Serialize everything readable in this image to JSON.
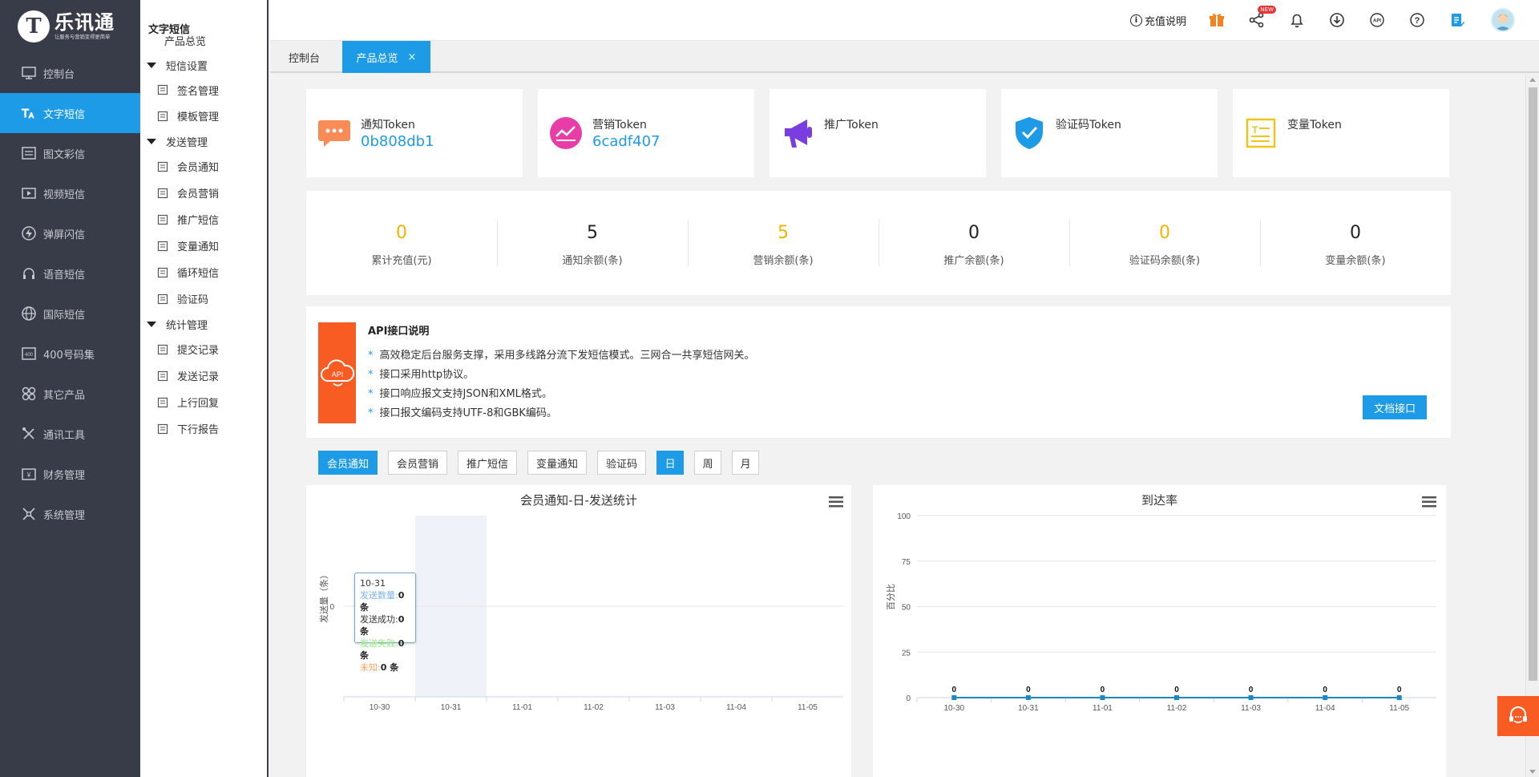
{
  "brand": {
    "title": "乐讯通",
    "subtitle": "让服务与营销变得更简单",
    "mark": "T"
  },
  "sidebar": {
    "items": [
      {
        "label": "控制台",
        "icon": "monitor-icon"
      },
      {
        "label": "文字短信",
        "icon": "text-icon",
        "active": true
      },
      {
        "label": "图文彩信",
        "icon": "image-icon"
      },
      {
        "label": "视频短信",
        "icon": "video-icon"
      },
      {
        "label": "弹屏闪信",
        "icon": "flash-icon"
      },
      {
        "label": "语音短信",
        "icon": "headset-icon"
      },
      {
        "label": "国际短信",
        "icon": "globe-icon"
      },
      {
        "label": "400号码集",
        "icon": "400-icon"
      },
      {
        "label": "其它产品",
        "icon": "grid-icon"
      },
      {
        "label": "通讯工具",
        "icon": "tools-icon"
      },
      {
        "label": "财务管理",
        "icon": "wallet-icon"
      },
      {
        "label": "系统管理",
        "icon": "settings-icon"
      }
    ]
  },
  "submenu": {
    "title": "文字短信",
    "overview": "产品总览",
    "groups": [
      {
        "label": "短信设置",
        "items": [
          "签名管理",
          "模板管理"
        ]
      },
      {
        "label": "发送管理",
        "items": [
          "会员通知",
          "会员营销",
          "推广短信",
          "变量通知",
          "循环短信",
          "验证码"
        ]
      },
      {
        "label": "统计管理",
        "items": [
          "提交记录",
          "发送记录",
          "上行回复",
          "下行报告"
        ]
      }
    ]
  },
  "topbar": {
    "recharge_label": "充值说明",
    "new_badge": "NEW"
  },
  "tabs": {
    "home": "控制台",
    "current": "产品总览",
    "close": "×"
  },
  "tokens": [
    {
      "name": "通知Token",
      "value": "0b808db1",
      "color": "#f98b57"
    },
    {
      "name": "营销Token",
      "value": "6cadf407",
      "color": "#e83ca8"
    },
    {
      "name": "推广Token",
      "value": "",
      "color": "#7a3ee0"
    },
    {
      "name": "验证码Token",
      "value": "",
      "color": "#1e9be6"
    },
    {
      "name": "变量Token",
      "value": "",
      "color": "#f2c318"
    }
  ],
  "stats": [
    {
      "value": "0",
      "label": "累计充值(元)",
      "highlight": true
    },
    {
      "value": "5",
      "label": "通知余额(条)",
      "highlight": false
    },
    {
      "value": "5",
      "label": "营销余额(条)",
      "highlight": true
    },
    {
      "value": "0",
      "label": "推广余额(条)",
      "highlight": false
    },
    {
      "value": "0",
      "label": "验证码余额(条)",
      "highlight": true
    },
    {
      "value": "0",
      "label": "变量余额(条)",
      "highlight": false
    }
  ],
  "api": {
    "badge": "API",
    "title": "API接口说明",
    "points": [
      "高效稳定后台服务支撑，采用多线路分流下发短信模式。三网合一共享短信网关。",
      "接口采用http协议。",
      "接口响应报文支持JSON和XML格式。",
      "接口报文编码支持UTF-8和GBK编码。"
    ],
    "doc_button": "文档接口"
  },
  "filters": {
    "types": [
      "会员通知",
      "会员营销",
      "推广短信",
      "变量通知",
      "验证码"
    ],
    "active_type": "会员通知",
    "periods": [
      "日",
      "周",
      "月"
    ],
    "active_period": "日"
  },
  "chart_data": [
    {
      "type": "bar",
      "title": "会员通知-日-发送统计",
      "ylabel": "发送量（条）",
      "categories": [
        "10-30",
        "10-31",
        "11-01",
        "11-02",
        "11-03",
        "11-04",
        "11-05"
      ],
      "yticks": [
        "0"
      ],
      "series": [
        {
          "name": "发送数量",
          "values": [
            0,
            0,
            0,
            0,
            0,
            0,
            0
          ],
          "color": "#7cb5ec"
        },
        {
          "name": "发送成功",
          "values": [
            0,
            0,
            0,
            0,
            0,
            0,
            0
          ],
          "color": "#434348"
        },
        {
          "name": "发送失败",
          "values": [
            0,
            0,
            0,
            0,
            0,
            0,
            0
          ],
          "color": "#90ed7d"
        },
        {
          "name": "未知",
          "values": [
            0,
            0,
            0,
            0,
            0,
            0,
            0
          ],
          "color": "#f7a35c"
        }
      ],
      "tooltip": {
        "date": "10-31",
        "rows": [
          {
            "label": "发送数量:",
            "value": "0 条",
            "color": "#7cb5ec"
          },
          {
            "label": "发送成功:",
            "value": "0 条",
            "color": "#333333"
          },
          {
            "label": "发送失败:",
            "value": "0 条",
            "color": "#90ed7d"
          },
          {
            "label": "未知:",
            "value": "0 条",
            "color": "#f7a35c"
          }
        ]
      }
    },
    {
      "type": "line",
      "title": "到达率",
      "ylabel": "百分比",
      "categories": [
        "10-30",
        "10-31",
        "11-01",
        "11-02",
        "11-03",
        "11-04",
        "11-05"
      ],
      "yticks": [
        0,
        25,
        50,
        75,
        100
      ],
      "ylim": [
        0,
        100
      ],
      "series": [
        {
          "values": [
            0,
            0,
            0,
            0,
            0,
            0,
            0
          ],
          "color": "#1e88c7"
        }
      ]
    }
  ]
}
